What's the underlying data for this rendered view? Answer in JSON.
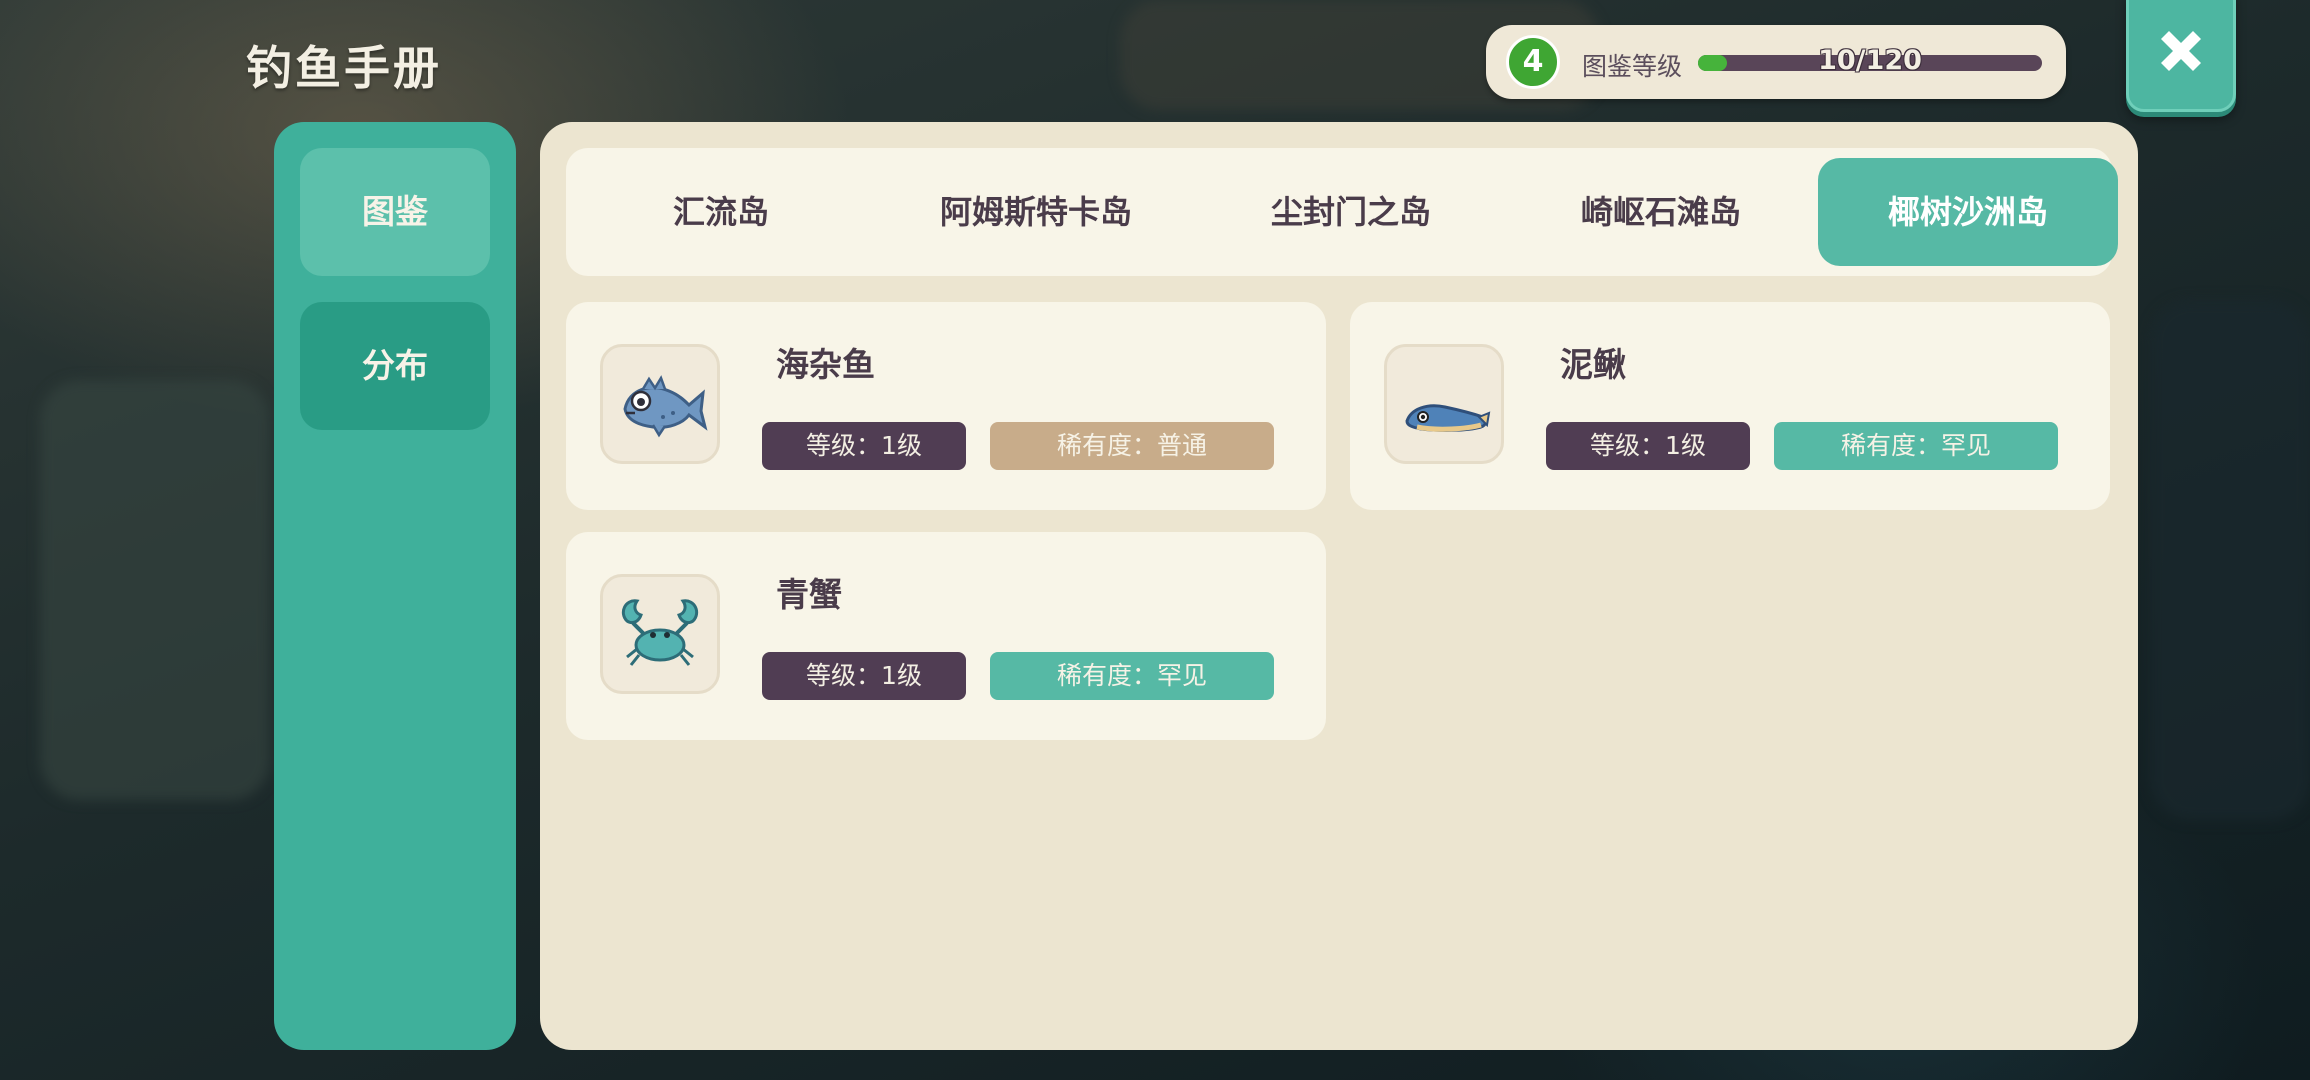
{
  "header": {
    "title": "钓鱼手册"
  },
  "level": {
    "value": "4",
    "label": "图鉴等级",
    "progress_text": "10/120",
    "progress_fraction": 0.083
  },
  "close_icon": "close-x-icon",
  "sidebar": {
    "items": [
      {
        "label": "图鉴",
        "selected": false
      },
      {
        "label": "分布",
        "selected": true
      }
    ]
  },
  "tabs": [
    {
      "label": "汇流岛",
      "active": false
    },
    {
      "label": "阿姆斯特卡岛",
      "active": false
    },
    {
      "label": "尘封门之岛",
      "active": false
    },
    {
      "label": "崎岖石滩岛",
      "active": false
    },
    {
      "label": "椰树沙洲岛",
      "active": true
    }
  ],
  "fish": [
    {
      "name": "海杂鱼",
      "level": "等级：1级",
      "rarity": "稀有度：普通",
      "rarity_color": "#c8ac8a",
      "icon": "spiky-fish-icon"
    },
    {
      "name": "泥鳅",
      "level": "等级：1级",
      "rarity": "稀有度：罕见",
      "rarity_color": "#56b9a5",
      "icon": "loach-icon"
    },
    {
      "name": "青蟹",
      "level": "等级：1级",
      "rarity": "稀有度：罕见",
      "rarity_color": "#56b9a5",
      "icon": "crab-icon"
    }
  ],
  "colors": {
    "accent": "#3fb09b",
    "panel": "#ece5d0",
    "tag_dark": "#503d53"
  }
}
